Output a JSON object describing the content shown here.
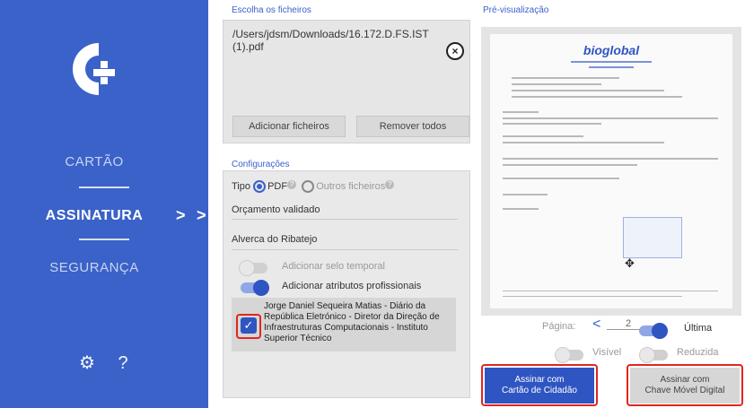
{
  "sidebar": {
    "items": [
      {
        "label": "CARTÃO"
      },
      {
        "label": "ASSINATURA"
      },
      {
        "label": "SEGURANÇA"
      }
    ],
    "active_chevron": ">",
    "outer_chevron": ">",
    "settings_glyph": "⚙",
    "help_glyph": "?"
  },
  "files": {
    "section_label": "Escolha os ficheiros",
    "selected_file": "/Users/jdsm/Downloads/16.172.D.FS.IST (1).pdf",
    "remove_glyph": "×",
    "add_button": "Adicionar ficheiros",
    "remove_all_button": "Remover todos"
  },
  "config": {
    "section_label": "Configurações",
    "tipo_label": "Tipo",
    "pdf_option": "PDF",
    "other_option": "Outros ficheiros",
    "help_glyph": "?",
    "reason_value": "Orçamento validado",
    "location_value": "Alverca do Ribatejo",
    "timestamp_label": "Adicionar selo temporal",
    "timestamp_enabled": false,
    "professional_label": "Adicionar atributos profissionais",
    "professional_enabled": true,
    "attribute_checked": true,
    "check_glyph": "✓",
    "attribute_text": "Jorge Daniel Sequeira Matias - Diário da República Eletrónico - Diretor da Direção de Infraestruturas Computacionais - Instituto Superior Técnico"
  },
  "preview": {
    "section_label": "Pré-visualização",
    "doc_logo": "bioglobal",
    "page_label": "Página:",
    "prev_arrow": "<",
    "page_value": "2",
    "last_label": "Última",
    "last_enabled": true,
    "visible_label": "Visível",
    "visible_enabled": false,
    "reduced_label": "Reduzida",
    "reduced_enabled": false
  },
  "actions": {
    "sign_cc_line1": "Assinar com",
    "sign_cc_line2": "Cartão de Cidadão",
    "sign_cmd_line1": "Assinar com",
    "sign_cmd_line2": "Chave Móvel Digital"
  },
  "colors": {
    "sidebar": "#3b62c8",
    "accent": "#2f55c2",
    "highlight": "#e0261f"
  }
}
